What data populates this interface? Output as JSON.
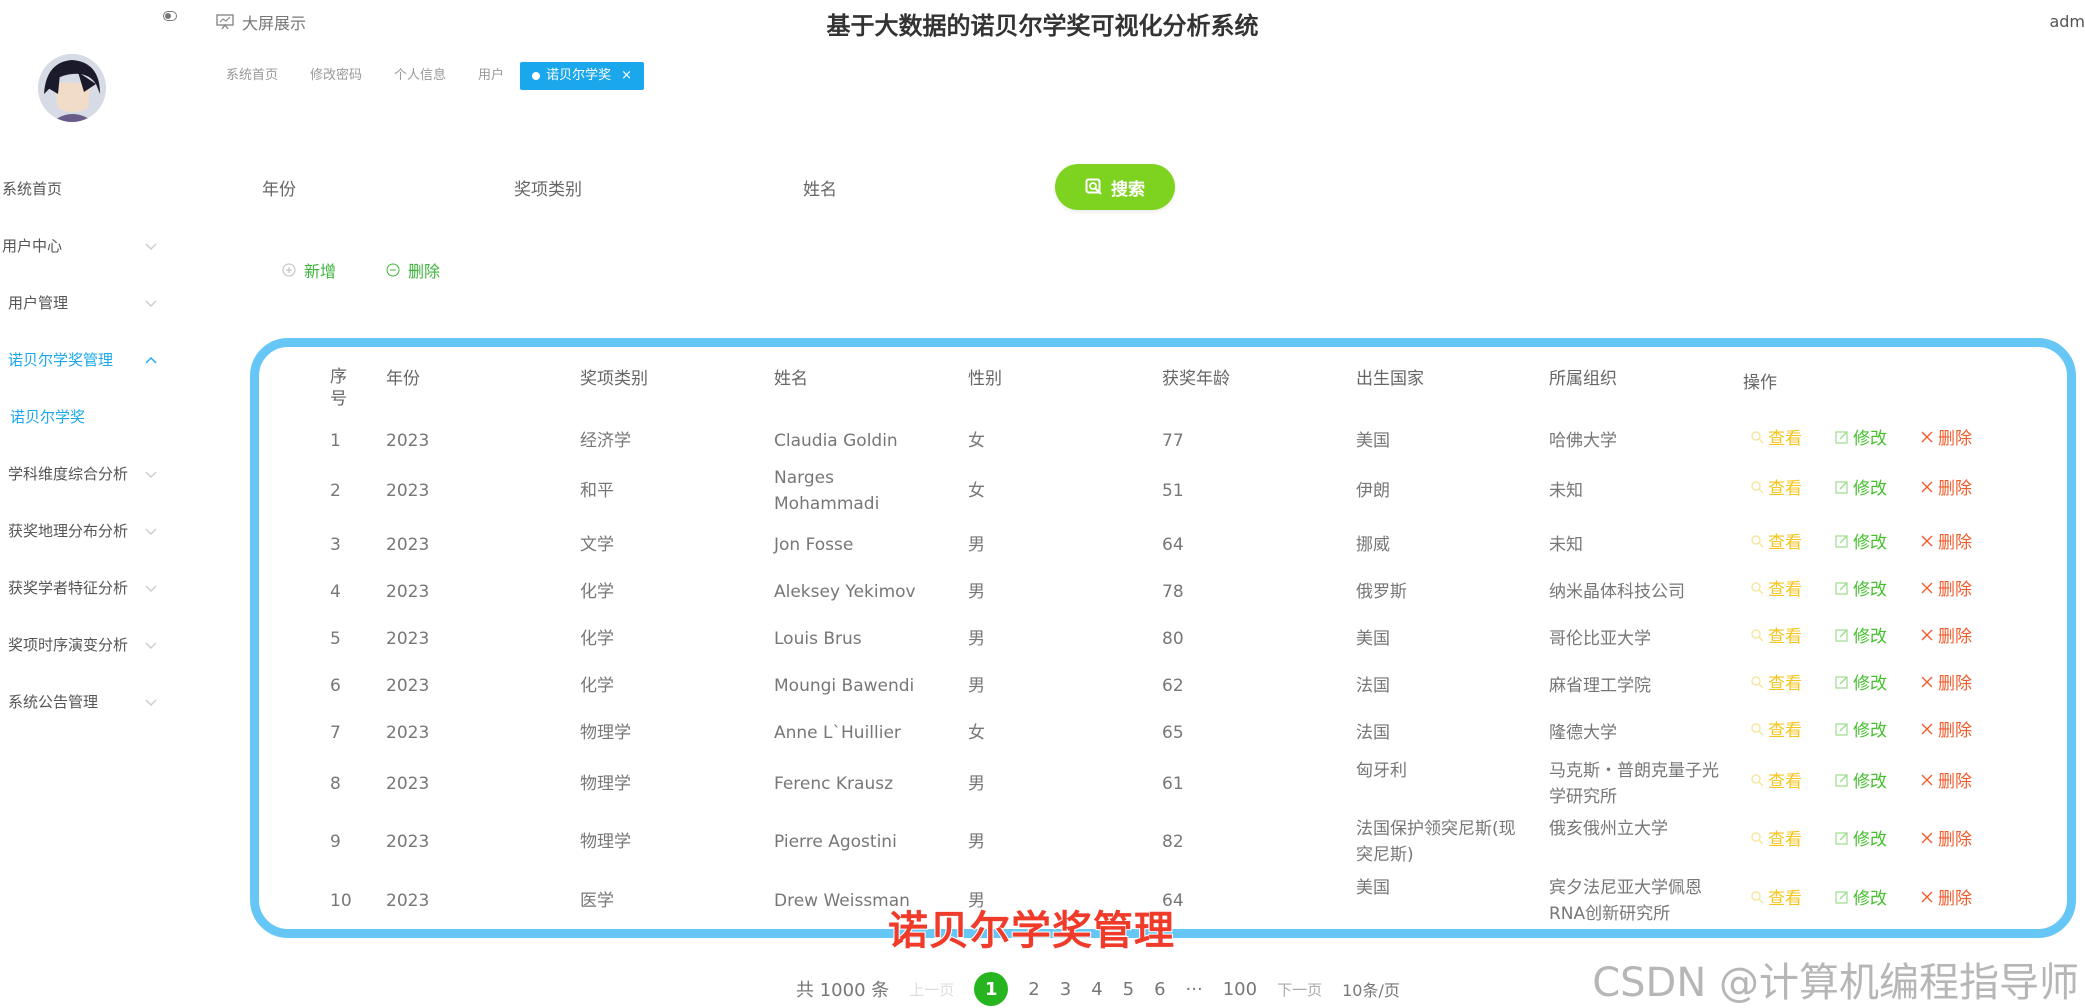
{
  "header": {
    "title": "基于大数据的诺贝尔学奖可视化分析系统",
    "bigscreen_label": "大屏展示",
    "user_name": "adm"
  },
  "tabs": [
    {
      "label": "系统首页"
    },
    {
      "label": "修改密码"
    },
    {
      "label": "个人信息"
    },
    {
      "label": "用户"
    },
    {
      "label": "诺贝尔学奖",
      "active": true
    }
  ],
  "tab_close_glyph": "×",
  "sidebar": {
    "items": [
      {
        "label": "系统首页"
      },
      {
        "label": "用户中心"
      },
      {
        "label": "用户管理"
      },
      {
        "label": "诺贝尔学奖管理"
      },
      {
        "label": "诺贝尔学奖"
      },
      {
        "label": "学科维度综合分析"
      },
      {
        "label": "获奖地理分布分析"
      },
      {
        "label": "获奖学者特征分析"
      },
      {
        "label": "奖项时序演变分析"
      },
      {
        "label": "系统公告管理"
      }
    ]
  },
  "filters": {
    "year_label": "年份",
    "category_label": "奖项类别",
    "name_label": "姓名",
    "search_button": "搜索"
  },
  "actions": {
    "add": "新增",
    "delete": "删除"
  },
  "table": {
    "headers": [
      "序号",
      "年份",
      "奖项类别",
      "姓名",
      "性别",
      "获奖年龄",
      "出生国家",
      "所属组织",
      "操作"
    ],
    "op_labels": {
      "view": "查看",
      "edit": "修改",
      "delete": "删除"
    },
    "rows": [
      [
        "1",
        "2023",
        "经济学",
        "Claudia Goldin",
        "女",
        "77",
        "美国",
        "哈佛大学"
      ],
      [
        "2",
        "2023",
        "和平",
        "Narges Mohammadi",
        "女",
        "51",
        "伊朗",
        "未知"
      ],
      [
        "3",
        "2023",
        "文学",
        "Jon Fosse",
        "男",
        "64",
        "挪威",
        "未知"
      ],
      [
        "4",
        "2023",
        "化学",
        "Aleksey Yekimov",
        "男",
        "78",
        "俄罗斯",
        "纳米晶体科技公司"
      ],
      [
        "5",
        "2023",
        "化学",
        "Louis Brus",
        "男",
        "80",
        "美国",
        "哥伦比亚大学"
      ],
      [
        "6",
        "2023",
        "化学",
        "Moungi Bawendi",
        "男",
        "62",
        "法国",
        "麻省理工学院"
      ],
      [
        "7",
        "2023",
        "物理学",
        "Anne L`Huillier",
        "女",
        "65",
        "法国",
        "隆德大学"
      ],
      [
        "8",
        "2023",
        "物理学",
        "Ferenc Krausz",
        "男",
        "61",
        "匈牙利",
        "马克斯・普朗克量子光学研究所"
      ],
      [
        "9",
        "2023",
        "物理学",
        "Pierre Agostini",
        "男",
        "82",
        "法国保护领突尼斯(现突尼斯)",
        "俄亥俄州立大学"
      ],
      [
        "10",
        "2023",
        "医学",
        "Drew Weissman",
        "男",
        "64",
        "美国",
        "宾夕法尼亚大学佩恩RNA创新研究所"
      ]
    ]
  },
  "overlay_caption": "诺贝尔学奖管理",
  "pagination": {
    "total": "共 1000 条",
    "prev": "上一页",
    "pages": [
      "1",
      "2",
      "3",
      "4",
      "5",
      "6",
      "···",
      "100"
    ],
    "next": "下一页",
    "page_size": "10条/页"
  },
  "watermark": "CSDN @计算机编程指导师",
  "colors": {
    "accent": "#1aa7ec",
    "search_button": "#7ed321",
    "table_border": "#66c7f7",
    "view": "#f5c51e",
    "edit": "#45c12d",
    "delete": "#f25c2c",
    "caption": "#f03a2a"
  }
}
